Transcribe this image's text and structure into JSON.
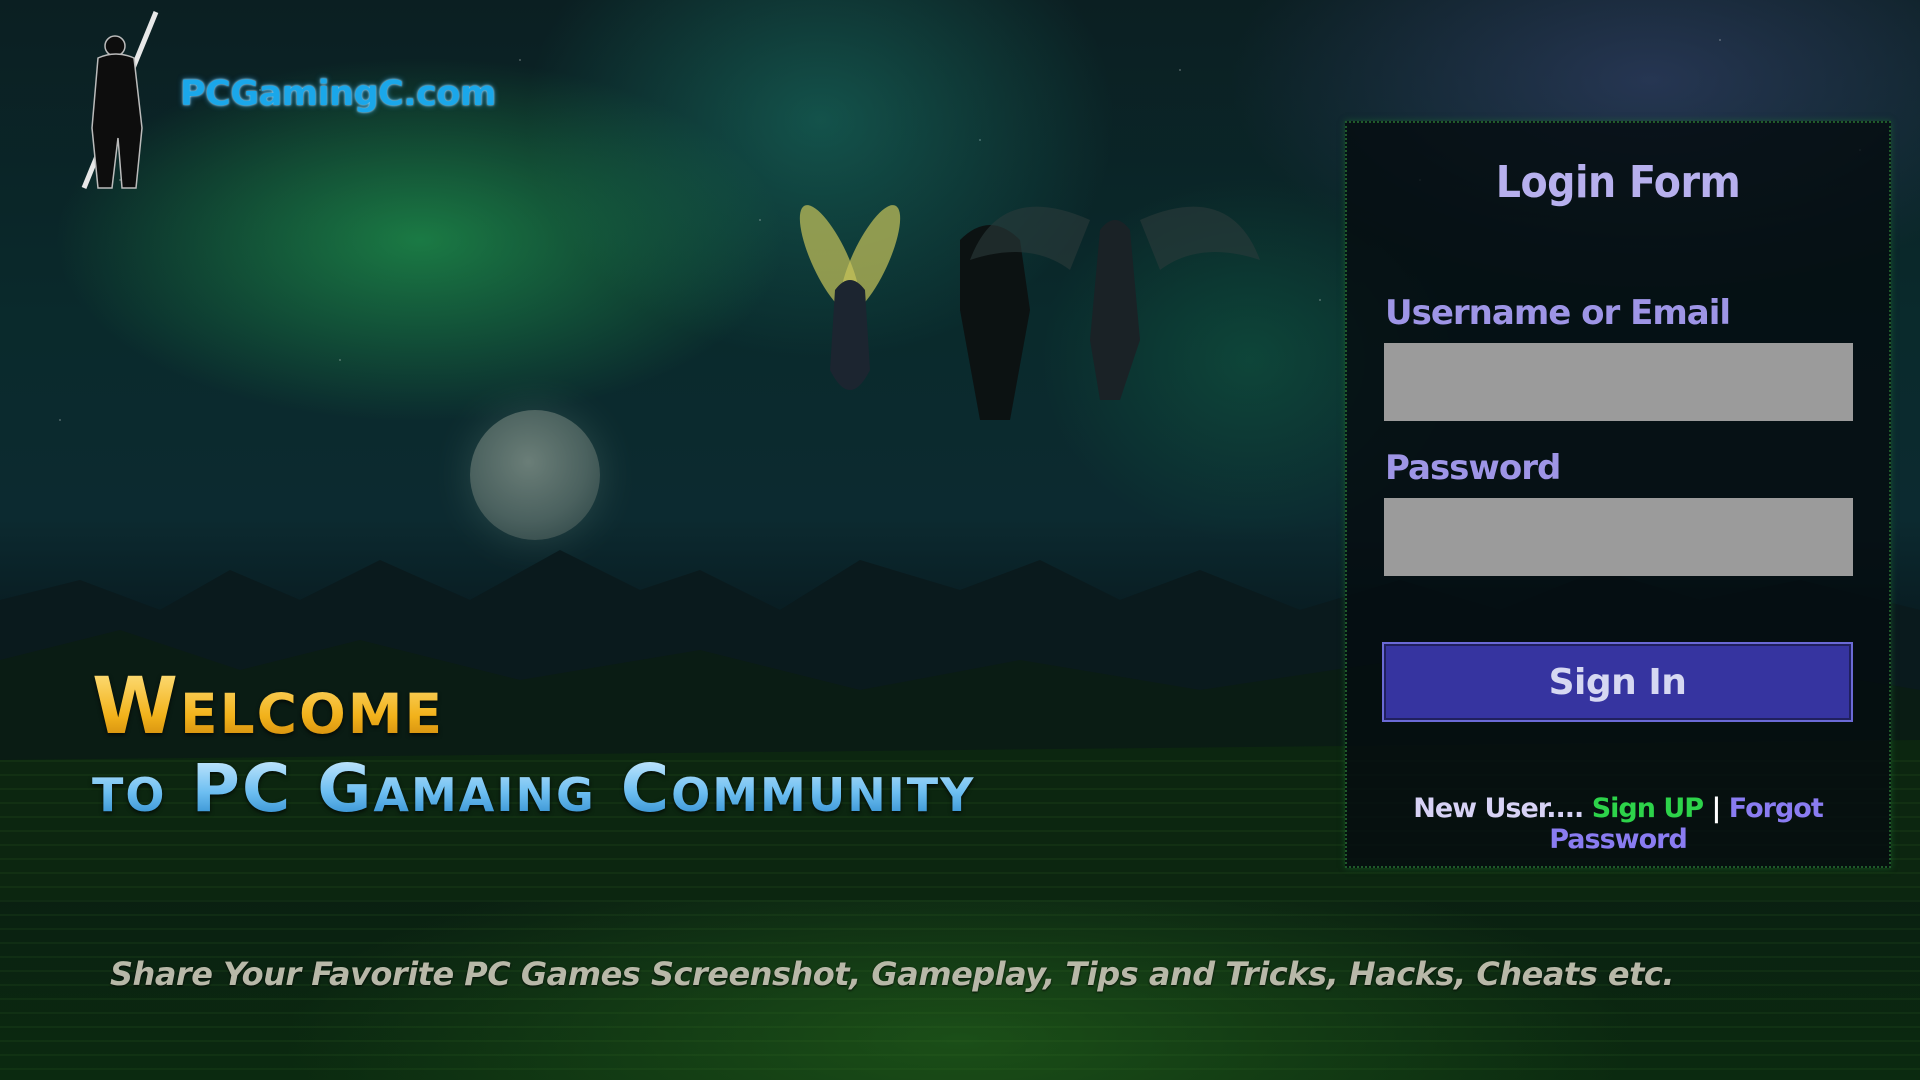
{
  "brand": {
    "site_name": "PCGamingC.com",
    "logo_icon": "swordsman-silhouette-icon",
    "accent_color": "#1aa7ea"
  },
  "hero": {
    "welcome_line1": "Welcome",
    "welcome_line2": "to PC Gamaing Community",
    "tagline": "Share Your Favorite PC Games Screenshot, Gameplay, Tips and Tricks, Hacks, Cheats etc."
  },
  "login": {
    "title": "Login Form",
    "username_label": "Username or Email",
    "username_value": "",
    "password_label": "Password",
    "password_value": "",
    "signin_label": "Sign In",
    "new_user_text": "New User....",
    "signup_link": "Sign UP",
    "separator": "|",
    "forgot_link": "Forgot Password",
    "colors": {
      "title": "#b7b0ee",
      "button": "#3634a0",
      "signup": "#2dd34a",
      "forgot": "#8a7cf1"
    }
  }
}
